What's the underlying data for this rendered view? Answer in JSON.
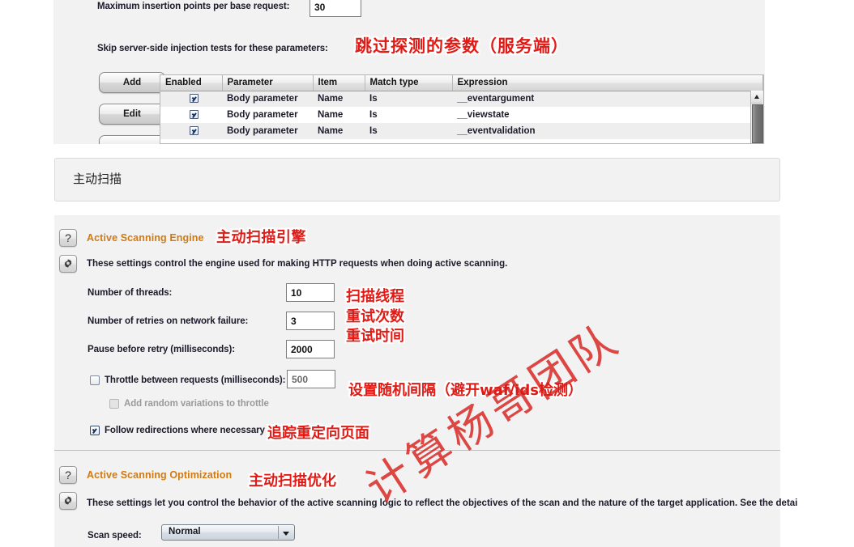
{
  "top_section": {
    "max_insertion_label": "Maximum insertion points per base request:",
    "max_insertion_value": "30",
    "skip_label": "Skip server-side injection tests for these parameters:",
    "skip_annotation": "跳过探测的参数（服务端）",
    "buttons": {
      "add": "Add",
      "edit": "Edit"
    },
    "table": {
      "headers": [
        "Enabled",
        "Parameter",
        "Item",
        "Match type",
        "Expression"
      ],
      "rows": [
        {
          "enabled": true,
          "parameter": "Body parameter",
          "item": "Name",
          "match_type": "Is",
          "expression": "__eventargument"
        },
        {
          "enabled": true,
          "parameter": "Body parameter",
          "item": "Name",
          "match_type": "Is",
          "expression": "__viewstate"
        },
        {
          "enabled": true,
          "parameter": "Body parameter",
          "item": "Name",
          "match_type": "Is",
          "expression": "__eventvalidation"
        }
      ]
    }
  },
  "section_header": {
    "title": "主动扫描"
  },
  "engine": {
    "icons": {
      "help": "?",
      "gear": "gear-icon"
    },
    "title": "Active Scanning Engine",
    "title_annotation": "主动扫描引擎",
    "description": "These settings control the engine used for making HTTP requests when doing active scanning.",
    "fields": [
      {
        "label": "Number of threads:",
        "value": "10"
      },
      {
        "label": "Number of retries on network failure:",
        "value": "3"
      },
      {
        "label": "Pause before retry (milliseconds):",
        "value": "2000"
      }
    ],
    "field_annotations": [
      "扫描线程",
      "重试次数",
      "重试时间"
    ],
    "throttle": {
      "label": "Throttle between requests (milliseconds):",
      "value": "500",
      "checked": false
    },
    "throttle_annotation": "设置随机间隔（避开waf/ids检测）",
    "random_variation": {
      "label": "Add random variations to throttle",
      "checked": false,
      "disabled": true
    },
    "follow_redirections": {
      "label": "Follow redirections where necessary",
      "checked": true
    },
    "follow_annotation": "追踪重定向页面"
  },
  "optimization": {
    "title": "Active Scanning Optimization",
    "title_annotation": "主动扫描优化",
    "description": "These settings let you control the behavior of the active scanning logic to reflect the objectives of the scan and the nature of the target application. See the detai",
    "scan_speed": {
      "label": "Scan speed:",
      "value": "Normal"
    }
  },
  "watermark": {
    "text": "计算杨哥团队"
  },
  "colors": {
    "accent": "#d07a14",
    "annotation": "#e01b16",
    "panel_bg": "#f2f2f2",
    "text": "#1b1b2b"
  }
}
